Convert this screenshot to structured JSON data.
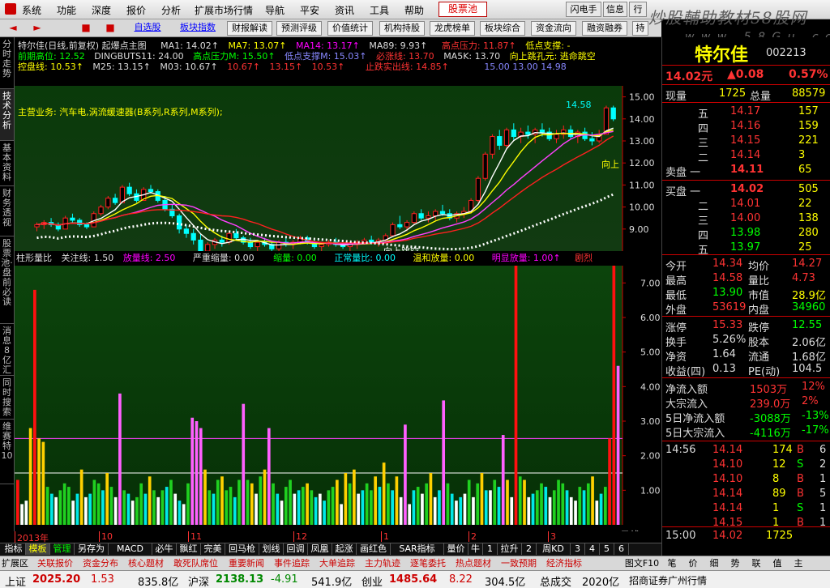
{
  "menubar": {
    "items": [
      "系统",
      "功能",
      "深度",
      "报价",
      "分析",
      "扩展市场行情",
      "导航",
      "平安",
      "资讯",
      "工具",
      "帮助"
    ],
    "stock_pool": "股票池",
    "right_buttons": [
      "闪电手",
      "信息",
      "行"
    ]
  },
  "watermark": {
    "text": "炒股輔助教材58股网",
    "url_text": "w w w . 5 8 G u . c o m"
  },
  "toolbar": {
    "arrows": [
      "◄",
      "►",
      "■",
      "■"
    ],
    "links": [
      "自选股",
      "板块指数"
    ],
    "buttons": [
      "财报解读",
      "预测评级",
      "价值统计",
      "机构持股",
      "龙虎榜单",
      "板块综合",
      "资金流向",
      "融资融券",
      "持"
    ]
  },
  "left_tabs": [
    "分时走势",
    "技术分析",
    "基本资料",
    "财务透视",
    "股票池·盘前必读",
    "消息8亿汇",
    "同时搜索",
    "维赛特10"
  ],
  "indicator_header": {
    "row1": {
      "title": "特尔佳(日线,前复权) 起爆点主图",
      "ma1": "MA1: 14.02↑",
      "ma7": "MA7: 13.07↑",
      "ma14": "MA14: 13.17↑",
      "ma89": "MA89: 9.93↑",
      "high_press": "高点压力: 11.87↑",
      "low_support": "低点支撑: -"
    },
    "row2": {
      "prev_high": "前期高位: 12.52",
      "dingbuts": "DINGBUTS11: 24.00",
      "high_press_m": "高点压力M: 15.50↑",
      "low_support_m": "低点支撑M: 15.03↑",
      "must_rise": "必涨线: 13.70",
      "ma5k": "MA5K: 13.70",
      "jump": "向上跳孔元: 逃命跳空"
    },
    "row3": {
      "ctrl": "控盘线: 10.53↑",
      "m25": "M25: 13.15↑",
      "m03": "M03: 10.67↑",
      "v1": "10.67↑",
      "v2": "13.15↑",
      "v3": "10.53↑",
      "top_out": "止跌实出线: 14.85↑",
      "right_vals": "15.00  13.00  14.98"
    },
    "concept": "主营业务: 汽车电,涡流缓速器(B系列,R系列,M系列);"
  },
  "chart_data": {
    "type": "candlestick",
    "title": "特尔佳(日线,前复权) 起爆点主图",
    "y_ticks": [
      9.0,
      10.0,
      11.0,
      12.0,
      13.0,
      14.0,
      15.0
    ],
    "ylim": [
      8.0,
      15.5
    ],
    "annotations": [
      "7.61",
      "14.58",
      "向上跳空",
      "向上"
    ],
    "x_labels": [
      "2013年",
      "10",
      "11",
      "12",
      "1",
      "2",
      "3"
    ],
    "candles": [
      [
        9.1,
        9.3,
        8.9,
        9.2
      ],
      [
        9.2,
        9.4,
        9.0,
        9.3
      ],
      [
        9.3,
        9.5,
        9.1,
        9.2
      ],
      [
        9.2,
        9.3,
        8.9,
        9.0
      ],
      [
        9.0,
        9.6,
        9.0,
        9.5
      ],
      [
        9.5,
        9.7,
        9.3,
        9.4
      ],
      [
        9.4,
        9.5,
        9.1,
        9.2
      ],
      [
        9.2,
        9.3,
        9.0,
        9.1
      ],
      [
        9.1,
        9.8,
        9.1,
        9.7
      ],
      [
        9.7,
        10.1,
        9.6,
        10.0
      ],
      [
        10.0,
        10.5,
        9.9,
        10.4
      ],
      [
        10.4,
        10.6,
        10.1,
        10.2
      ],
      [
        10.2,
        11.0,
        10.2,
        10.9
      ],
      [
        10.9,
        11.1,
        10.5,
        10.6
      ],
      [
        10.6,
        10.8,
        10.2,
        10.3
      ],
      [
        10.3,
        10.9,
        10.3,
        10.8
      ],
      [
        10.8,
        11.0,
        10.6,
        10.7
      ],
      [
        10.7,
        10.8,
        10.2,
        10.3
      ],
      [
        10.3,
        10.5,
        9.8,
        9.9
      ],
      [
        9.9,
        10.1,
        9.5,
        9.6
      ],
      [
        9.6,
        9.7,
        8.8,
        9.0
      ],
      [
        9.0,
        9.2,
        8.6,
        8.8
      ],
      [
        8.8,
        9.0,
        8.3,
        8.5
      ],
      [
        8.5,
        8.8,
        7.9,
        8.0
      ],
      [
        8.0,
        8.4,
        7.6,
        8.3
      ],
      [
        8.3,
        8.6,
        8.1,
        8.5
      ],
      [
        8.5,
        8.7,
        8.2,
        8.4
      ],
      [
        8.4,
        8.9,
        8.3,
        8.8
      ],
      [
        8.8,
        9.0,
        8.5,
        8.6
      ],
      [
        8.6,
        8.7,
        8.3,
        8.4
      ],
      [
        8.4,
        8.6,
        8.1,
        8.2
      ],
      [
        8.2,
        8.5,
        8.0,
        8.4
      ],
      [
        8.4,
        8.6,
        8.2,
        8.3
      ],
      [
        8.3,
        8.4,
        8.0,
        8.1
      ],
      [
        8.1,
        8.5,
        8.0,
        8.4
      ],
      [
        8.4,
        8.6,
        8.2,
        8.3
      ],
      [
        8.3,
        8.5,
        8.1,
        8.4
      ],
      [
        8.4,
        8.7,
        8.3,
        8.6
      ],
      [
        8.6,
        8.7,
        8.3,
        8.4
      ],
      [
        8.4,
        8.5,
        8.1,
        8.2
      ],
      [
        8.2,
        8.4,
        8.0,
        8.3
      ],
      [
        8.3,
        8.5,
        8.2,
        8.4
      ],
      [
        8.4,
        8.6,
        8.2,
        8.3
      ],
      [
        8.3,
        8.4,
        8.1,
        8.2
      ],
      [
        8.2,
        8.4,
        8.0,
        8.3
      ],
      [
        8.3,
        8.5,
        8.1,
        8.4
      ],
      [
        8.4,
        8.6,
        8.3,
        8.5
      ],
      [
        8.5,
        8.7,
        8.3,
        8.4
      ],
      [
        8.4,
        8.6,
        8.2,
        8.5
      ],
      [
        8.5,
        8.8,
        8.4,
        8.7
      ],
      [
        8.7,
        9.3,
        8.7,
        9.2
      ],
      [
        9.2,
        9.6,
        9.0,
        9.1
      ],
      [
        9.1,
        9.4,
        8.9,
        9.3
      ],
      [
        9.3,
        9.8,
        9.2,
        9.7
      ],
      [
        9.7,
        9.9,
        9.4,
        9.5
      ],
      [
        9.5,
        9.8,
        9.3,
        9.6
      ],
      [
        9.6,
        9.9,
        9.4,
        9.8
      ],
      [
        9.8,
        10.1,
        9.6,
        9.7
      ],
      [
        9.7,
        9.9,
        9.4,
        9.5
      ],
      [
        9.5,
        9.8,
        9.3,
        9.7
      ],
      [
        9.7,
        10.0,
        9.5,
        9.8
      ],
      [
        9.8,
        10.4,
        9.7,
        10.3
      ],
      [
        10.3,
        11.4,
        10.2,
        11.3
      ],
      [
        11.3,
        12.5,
        11.2,
        12.4
      ],
      [
        12.4,
        13.3,
        12.2,
        13.2
      ],
      [
        13.2,
        13.5,
        12.6,
        12.8
      ],
      [
        12.8,
        13.6,
        12.7,
        13.5
      ],
      [
        13.5,
        13.8,
        13.0,
        13.2
      ],
      [
        13.2,
        13.6,
        12.9,
        13.4
      ],
      [
        13.4,
        13.7,
        13.1,
        13.3
      ],
      [
        13.3,
        13.6,
        12.9,
        13.5
      ],
      [
        13.5,
        13.8,
        13.2,
        13.4
      ],
      [
        13.4,
        13.6,
        13.0,
        13.1
      ],
      [
        13.1,
        13.5,
        12.9,
        13.3
      ],
      [
        13.3,
        13.7,
        13.1,
        13.5
      ],
      [
        13.5,
        13.7,
        13.1,
        13.2
      ],
      [
        13.2,
        13.5,
        12.9,
        13.4
      ],
      [
        13.4,
        13.6,
        13.0,
        13.1
      ],
      [
        13.1,
        13.4,
        12.8,
        13.0
      ],
      [
        13.0,
        13.5,
        12.9,
        13.3
      ],
      [
        13.3,
        14.6,
        13.3,
        14.5
      ],
      [
        14.5,
        14.6,
        13.9,
        14.0
      ]
    ]
  },
  "volume_header": {
    "name": "柱形量比",
    "focus": "关注线: 1.50",
    "vol_line": "放量线: 2.50",
    "severe": "严重缩量: 0.00",
    "shrink": "缩量: 0.00",
    "normal": "正常量比: 0.00",
    "mild": "温和放量: 0.00",
    "obvious": "明显放量: 1.00↑",
    "surge": "剧烈"
  },
  "volume_data": {
    "y_ticks": [
      1.0,
      2.0,
      3.0,
      4.0,
      5.0,
      6.0,
      7.0
    ],
    "ylim": [
      0,
      7.5
    ],
    "values": [
      1.3,
      0.6,
      0.7,
      2.8,
      6.8,
      2.5,
      2.4,
      1.1,
      0.9,
      0.8,
      1.0,
      1.2,
      1.1,
      0.7,
      0.9,
      1.6,
      0.8,
      0.9,
      1.3,
      1.2,
      1.0,
      1.5,
      1.1,
      0.8,
      3.8,
      1.0,
      0.9,
      0.7,
      0.8,
      1.2,
      0.9,
      1.4,
      1.0,
      0.8,
      1.0,
      1.1,
      1.3,
      0.9,
      0.7,
      0.6,
      1.2,
      3.1,
      3.0,
      2.8,
      1.6,
      1.0,
      0.9,
      1.3,
      1.4,
      1.0,
      1.1,
      0.8,
      1.3,
      3.5,
      1.3,
      1.2,
      0.9,
      1.4,
      1.6,
      2.8,
      1.2,
      0.9,
      0.7,
      1.1,
      1.3,
      0.9,
      1.0,
      1.1,
      1.2,
      1.0,
      0.8,
      0.9,
      0.7,
      1.0,
      1.1,
      1.3,
      0.6,
      1.5,
      1.2,
      1.6,
      0.9,
      1.0,
      1.2,
      1.0,
      1.4,
      1.1,
      1.8,
      1.2,
      1.0,
      1.4,
      0.8,
      2.9,
      0.6,
      1.0,
      1.1,
      0.9,
      1.2,
      1.5,
      0.8,
      1.0,
      3.6,
      1.2,
      0.9,
      0.7,
      0.8,
      0.9,
      1.3,
      0.8,
      1.2,
      1.5,
      1.0,
      1.0,
      1.3,
      1.1,
      2.6,
      1.3,
      0.8,
      7.6,
      1.4,
      1.3,
      0.8,
      0.9,
      1.0,
      1.2,
      1.1,
      0.8,
      1.0,
      1.3,
      1.2,
      1.0,
      0.8,
      0.7,
      1.1,
      1.0,
      1.2,
      1.4,
      0.7,
      0.9,
      1.1,
      2.5,
      8.1,
      4.6
    ],
    "colors": [
      "r",
      "w",
      "w",
      "y",
      "r",
      "y",
      "y",
      "g",
      "c",
      "w",
      "g",
      "g",
      "g",
      "w",
      "c",
      "y",
      "w",
      "c",
      "g",
      "g",
      "c",
      "y",
      "g",
      "w",
      "p",
      "g",
      "c",
      "w",
      "g",
      "g",
      "c",
      "y",
      "g",
      "w",
      "g",
      "c",
      "g",
      "w",
      "c",
      "w",
      "g",
      "p",
      "p",
      "p",
      "y",
      "g",
      "c",
      "g",
      "y",
      "g",
      "g",
      "c",
      "g",
      "p",
      "g",
      "y",
      "w",
      "g",
      "y",
      "p",
      "g",
      "c",
      "w",
      "g",
      "g",
      "w",
      "c",
      "g",
      "y",
      "g",
      "c",
      "w",
      "c",
      "g",
      "g",
      "y",
      "w",
      "y",
      "g",
      "y",
      "w",
      "c",
      "g",
      "g",
      "y",
      "c",
      "y",
      "g",
      "c",
      "y",
      "w",
      "p",
      "w",
      "c",
      "g",
      "w",
      "g",
      "y",
      "w",
      "c",
      "p",
      "g",
      "c",
      "w",
      "c",
      "w",
      "g",
      "w",
      "g",
      "y",
      "c",
      "w",
      "g",
      "c",
      "p",
      "y",
      "w",
      "r",
      "g",
      "y",
      "w",
      "c",
      "g",
      "g",
      "c",
      "w",
      "g",
      "g",
      "g",
      "c",
      "w",
      "w",
      "g",
      "c",
      "g",
      "y",
      "w",
      "c",
      "g",
      "r",
      "r",
      "p"
    ]
  },
  "bottom_tabs": [
    "指标",
    "模板",
    "管理",
    "另存为",
    "MACD",
    "必牛",
    "飘红",
    "完美",
    "回马枪",
    "划线",
    "回调",
    "凤凰",
    "起涨",
    "画红色",
    "SAR指标",
    "量价",
    "牛",
    "1",
    "拉升",
    "2",
    "周KD",
    "3",
    "4",
    "5",
    "6"
  ],
  "right_panel": {
    "name": "特尔佳",
    "code": "002213",
    "price": "14.02元",
    "change": "▲0.08",
    "pct": "0.57%",
    "now_label": "现量",
    "now": "1725",
    "total_label": "总量",
    "total": "88579",
    "sells": [
      {
        "label": "五",
        "price": "14.17",
        "vol": "157"
      },
      {
        "label": "四",
        "price": "14.16",
        "vol": "159"
      },
      {
        "label": "三",
        "price": "14.15",
        "vol": "221"
      },
      {
        "label": "二",
        "price": "14.14",
        "vol": "3"
      },
      {
        "label": "卖盘 一",
        "price": "14.11",
        "vol": "65"
      }
    ],
    "buys": [
      {
        "label": "买盘 一",
        "price": "14.02",
        "vol": "505"
      },
      {
        "label": "二",
        "price": "14.01",
        "vol": "22"
      },
      {
        "label": "三",
        "price": "14.00",
        "vol": "138"
      },
      {
        "label": "四",
        "price": "13.98",
        "vol": "280"
      },
      {
        "label": "五",
        "price": "13.97",
        "vol": "25"
      }
    ],
    "stats": [
      {
        "l1": "今开",
        "v1": "14.34",
        "l2": "均价",
        "v2": "14.27"
      },
      {
        "l1": "最高",
        "v1": "14.58",
        "l2": "量比",
        "v2": "4.73"
      },
      {
        "l1": "最低",
        "v1": "13.90",
        "l2": "市值",
        "v2": "28.9亿"
      },
      {
        "l1": "外盘",
        "v1": "53619",
        "l2": "内盘",
        "v2": "34960"
      }
    ],
    "stats2": [
      {
        "l1": "涨停",
        "v1": "15.33",
        "l2": "跌停",
        "v2": "12.55"
      },
      {
        "l1": "换手",
        "v1": "5.26%",
        "l2": "股本",
        "v2": "2.06亿"
      },
      {
        "l1": "净资",
        "v1": "1.64",
        "l2": "流通",
        "v2": "1.68亿"
      },
      {
        "l1": "收益(四)",
        "v1": "0.13",
        "l2": "PE(动)",
        "v2": "104.5"
      }
    ],
    "flows": [
      {
        "label": "净流入额",
        "v": "1503万",
        "p": "12%"
      },
      {
        "label": "大宗流入",
        "v": "239.0万",
        "p": "2%"
      },
      {
        "label": "5日净流入额",
        "v": "-3088万",
        "p": "-13%"
      },
      {
        "label": "5日大宗流入",
        "v": "-4116万",
        "p": "-17%"
      }
    ],
    "ticks": [
      {
        "t": "14:56",
        "p": "14.14",
        "v": "174",
        "s": "B",
        "n": "6"
      },
      {
        "t": "",
        "p": "14.10",
        "v": "12",
        "s": "S",
        "n": "2"
      },
      {
        "t": "",
        "p": "14.10",
        "v": "8",
        "s": "B",
        "n": "1"
      },
      {
        "t": "",
        "p": "14.14",
        "v": "89",
        "s": "B",
        "n": "5"
      },
      {
        "t": "",
        "p": "14.14",
        "v": "1",
        "s": "S",
        "n": "1"
      },
      {
        "t": "",
        "p": "14.15",
        "v": "1",
        "s": "B",
        "n": "1"
      }
    ],
    "last_tick": {
      "t": "15:00",
      "p": "14.02",
      "v": "1725"
    },
    "period": "日线"
  },
  "feature_bar": [
    "扩展区",
    "关联报价",
    "资金分布",
    "核心题材",
    "敢死队席位",
    "重要新闻",
    "事件追踪",
    "大单追踪",
    "主力轨迹",
    "逐笔委托",
    "热点题材",
    "一致预期",
    "经济指标"
  ],
  "feature_right": [
    "图文F10",
    "笔",
    "价",
    "细",
    "势",
    "联",
    "值",
    "主"
  ],
  "statusbar": {
    "sh_label": "上证",
    "sh_val": "2025.20",
    "sh_chg": "1.53",
    "sh_amt": "835.8亿",
    "sz_label": "沪深",
    "sz_val": "2138.13",
    "sz_chg": "-4.91",
    "sz_amt": "541.9亿",
    "cy_label": "创业",
    "cy_val": "1485.64",
    "cy_chg": "8.22",
    "cy_amt": "304.5亿",
    "total_label": "总成交",
    "total_val": "2020亿",
    "broker": "招商证券广州行情"
  }
}
